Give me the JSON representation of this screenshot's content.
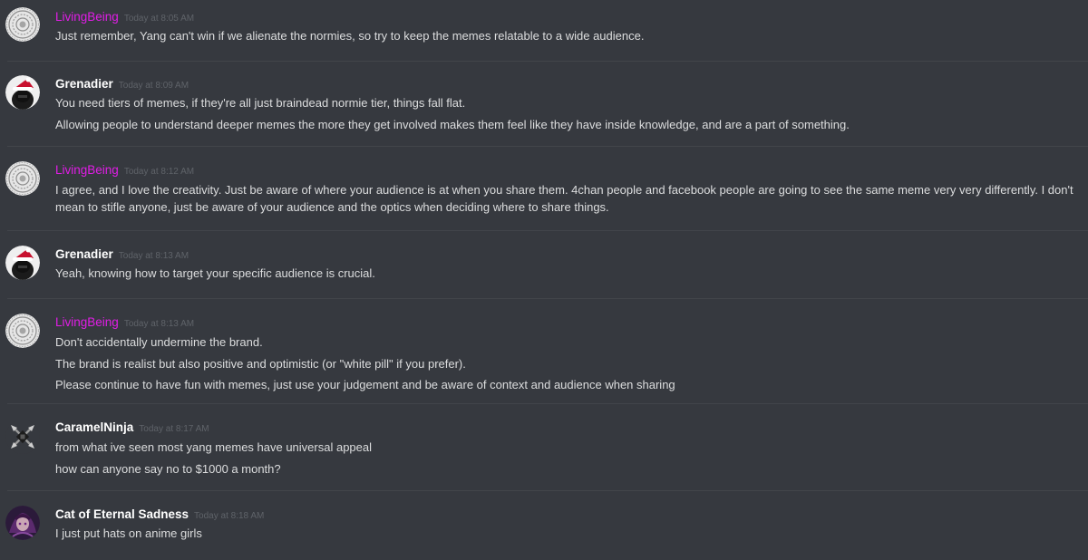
{
  "messages": [
    {
      "user": "LivingBeing",
      "time": "Today at 8:05 AM",
      "user_color": "#e11de6",
      "avatar_icon": "mandala-avatar-icon",
      "lines": [
        "Just remember, Yang can't win if we alienate the normies, so try to keep the memes relatable to a wide audience."
      ]
    },
    {
      "user": "Grenadier",
      "time": "Today at 8:09 AM",
      "user_color": "#ffffff",
      "avatar_icon": "santa-hat-avatar-icon",
      "lines": [
        "You need tiers of memes, if they're all just braindead normie tier, things fall flat.",
        "Allowing people to understand deeper memes the more they get involved makes them feel like they have inside knowledge, and are a part of something."
      ]
    },
    {
      "user": "LivingBeing",
      "time": "Today at 8:12 AM",
      "user_color": "#e11de6",
      "avatar_icon": "mandala-avatar-icon",
      "lines": [
        "I agree, and I love the creativity.  Just be aware of where your audience is at when you share them.  4chan people and facebook people are going to see the same meme very very differently.  I don't mean to stifle anyone, just be aware of your audience and the optics when deciding where to share things."
      ]
    },
    {
      "user": "Grenadier",
      "time": "Today at 8:13 AM",
      "user_color": "#ffffff",
      "avatar_icon": "santa-hat-avatar-icon",
      "lines": [
        "Yeah, knowing how to target your specific audience is crucial."
      ]
    },
    {
      "user": "LivingBeing",
      "time": "Today at 8:13 AM",
      "user_color": "#e11de6",
      "avatar_icon": "mandala-avatar-icon",
      "lines": [
        "Don't accidentally undermine the brand.",
        "The brand is realist but also positive and optimistic (or \"white pill\" if you prefer).",
        "Please continue to have fun with memes, just use your judgement and be aware of context and audience when sharing"
      ]
    },
    {
      "user": "CaramelNinja",
      "time": "Today at 8:17 AM",
      "user_color": "#ffffff",
      "avatar_icon": "shuriken-avatar-icon",
      "lines": [
        "from what ive seen most yang memes have universal appeal",
        "how can anyone say no to $1000 a month?"
      ]
    },
    {
      "user": "Cat of Eternal Sadness",
      "time": "Today at 8:18 AM",
      "user_color": "#ffffff",
      "avatar_icon": "anime-avatar-icon",
      "lines": [
        "I just put hats on anime girls"
      ]
    }
  ]
}
